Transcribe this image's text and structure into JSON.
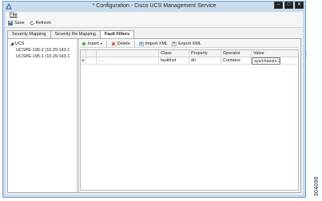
{
  "window": {
    "title": "* Configuration - Cisco UCS Management Service"
  },
  "menu": {
    "file": "File"
  },
  "toolbar": {
    "save": "Save",
    "refresh": "Refresh"
  },
  "tabs": [
    {
      "label": "Severity Mapping"
    },
    {
      "label": "Severity Re-Mapping"
    },
    {
      "label": "Fault Filters"
    }
  ],
  "tree": {
    "root": "UCS",
    "children": [
      "UCSPE-195-2 (10.29.143.1",
      "UCSPE-195-1 (10.29.143.1"
    ]
  },
  "right_toolbar": {
    "insert": "Insert",
    "delete": "Delete",
    "import": "Import XML",
    "export": "Export XML"
  },
  "grid": {
    "columns": [
      "Class",
      "Property",
      "Operator",
      "Value"
    ],
    "rows": [
      {
        "marker": "▸",
        "placeholder": "......",
        "class": "faultInst",
        "property": "dn",
        "operator": "Contains",
        "value": "sys/chassis-2/"
      }
    ]
  },
  "watermark": "304096"
}
